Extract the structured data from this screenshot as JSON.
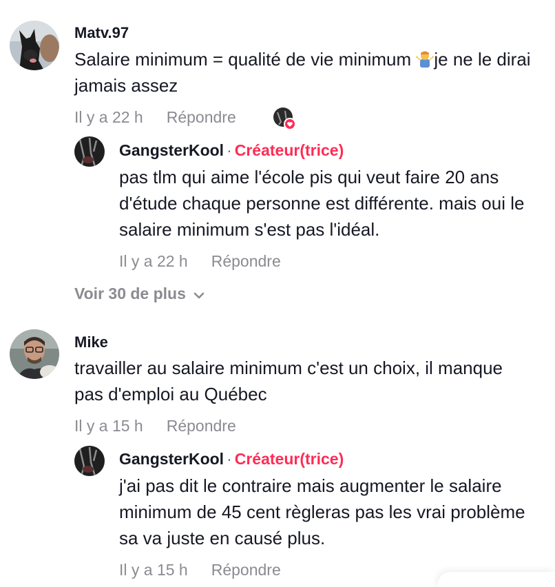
{
  "comments": [
    {
      "username": "Matv.97",
      "text_before_emoji": "Salaire minimum = qualité de vie minimum ",
      "emoji_icon": "person-shrugging-emoji",
      "text_after_emoji": "je ne le dirai jamais assez",
      "time": "Il y a 22 h",
      "reply_label": "Répondre",
      "creator_reply": {
        "username": "GangsterKool",
        "separator": "·",
        "badge": "Créateur(trice)",
        "text": "pas tlm qui aime l'école pis qui veut faire 20 ans d'étude chaque personne est différente. mais oui le salaire minimum s'est pas l'idéal.",
        "time": "Il y a 22 h",
        "reply_label": "Répondre"
      },
      "see_more": "Voir 30 de plus"
    },
    {
      "username": "Mike",
      "text": "travailler au salaire minimum c'est un choix, il manque pas d'emploi au Québec",
      "time": "Il y a 15 h",
      "reply_label": "Répondre",
      "creator_reply": {
        "username": "GangsterKool",
        "separator": "·",
        "badge": "Créateur(trice)",
        "text": "j'ai pas dit le contraire mais augmenter le salaire minimum de 45 cent règleras pas les vrai problème sa va juste en causé plus.",
        "time": "Il y a 15 h",
        "reply_label": "Répondre"
      }
    }
  ],
  "colors": {
    "text": "#161823",
    "muted": "#8a8b91",
    "creator_badge": "#fe2c55"
  }
}
